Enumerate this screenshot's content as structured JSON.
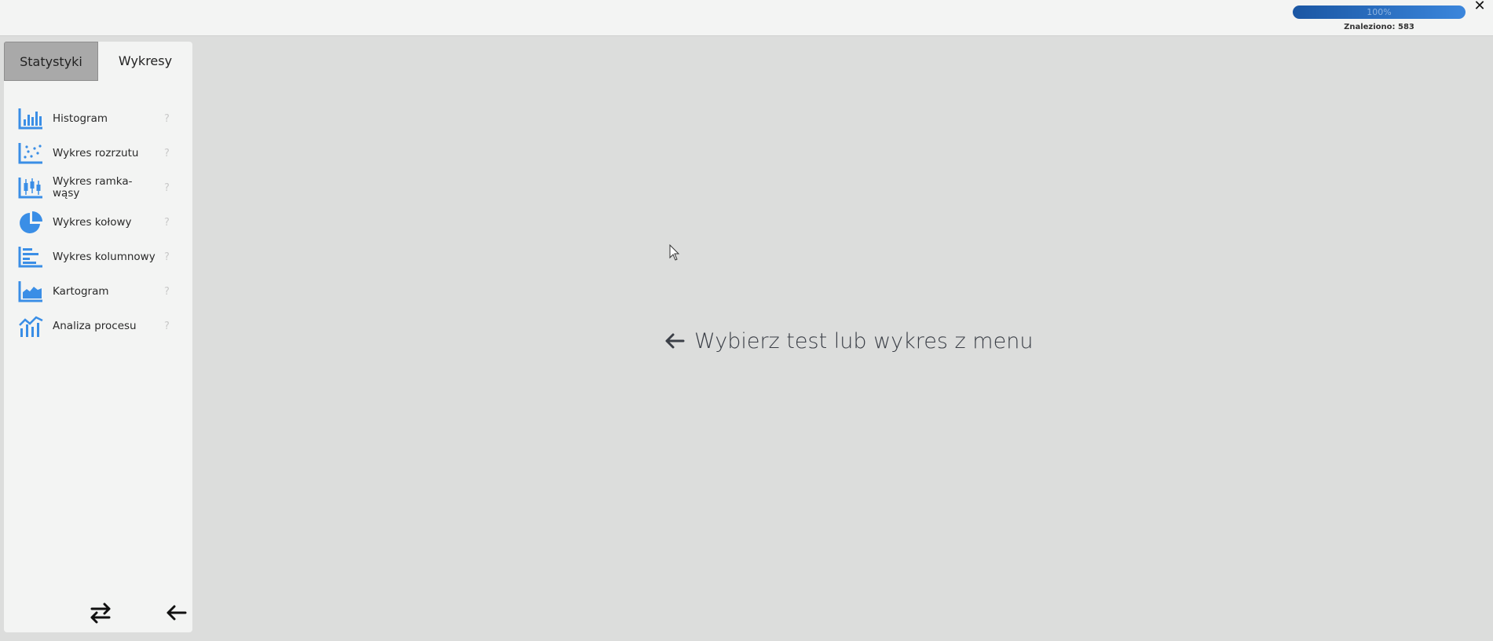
{
  "header": {
    "progress_label": "100%",
    "progress_fraction": 1.0,
    "found_label": "Znaleziono: 583",
    "close_glyph": "✕"
  },
  "sidebar": {
    "tabs": [
      {
        "label": "Statystyki",
        "active": true
      },
      {
        "label": "Wykresy",
        "active": false
      }
    ],
    "items": [
      {
        "label": "Histogram",
        "icon": "histogram-icon",
        "help": "?"
      },
      {
        "label": "Wykres rozrzutu",
        "icon": "scatter-icon",
        "help": "?"
      },
      {
        "label": "Wykres ramka-wąsy",
        "icon": "boxplot-icon",
        "help": "?"
      },
      {
        "label": "Wykres kołowy",
        "icon": "pie-chart-icon",
        "help": "?"
      },
      {
        "label": "Wykres kolumnowy",
        "icon": "bar-chart-icon",
        "help": "?"
      },
      {
        "label": "Kartogram",
        "icon": "area-chart-icon",
        "help": "?"
      },
      {
        "label": "Analiza procesu",
        "icon": "process-analysis-icon",
        "help": "?"
      }
    ],
    "bottom_buttons": [
      "swap-icon",
      "back-arrow-icon"
    ]
  },
  "main": {
    "hint_text": "Wybierz test lub wykres z menu"
  },
  "colors": {
    "accent": "#3a8ee6",
    "progress": "#2d74c9",
    "background": "#dcdddc",
    "panel": "#f3f4f3",
    "active_tab": "#a9a9a9"
  }
}
